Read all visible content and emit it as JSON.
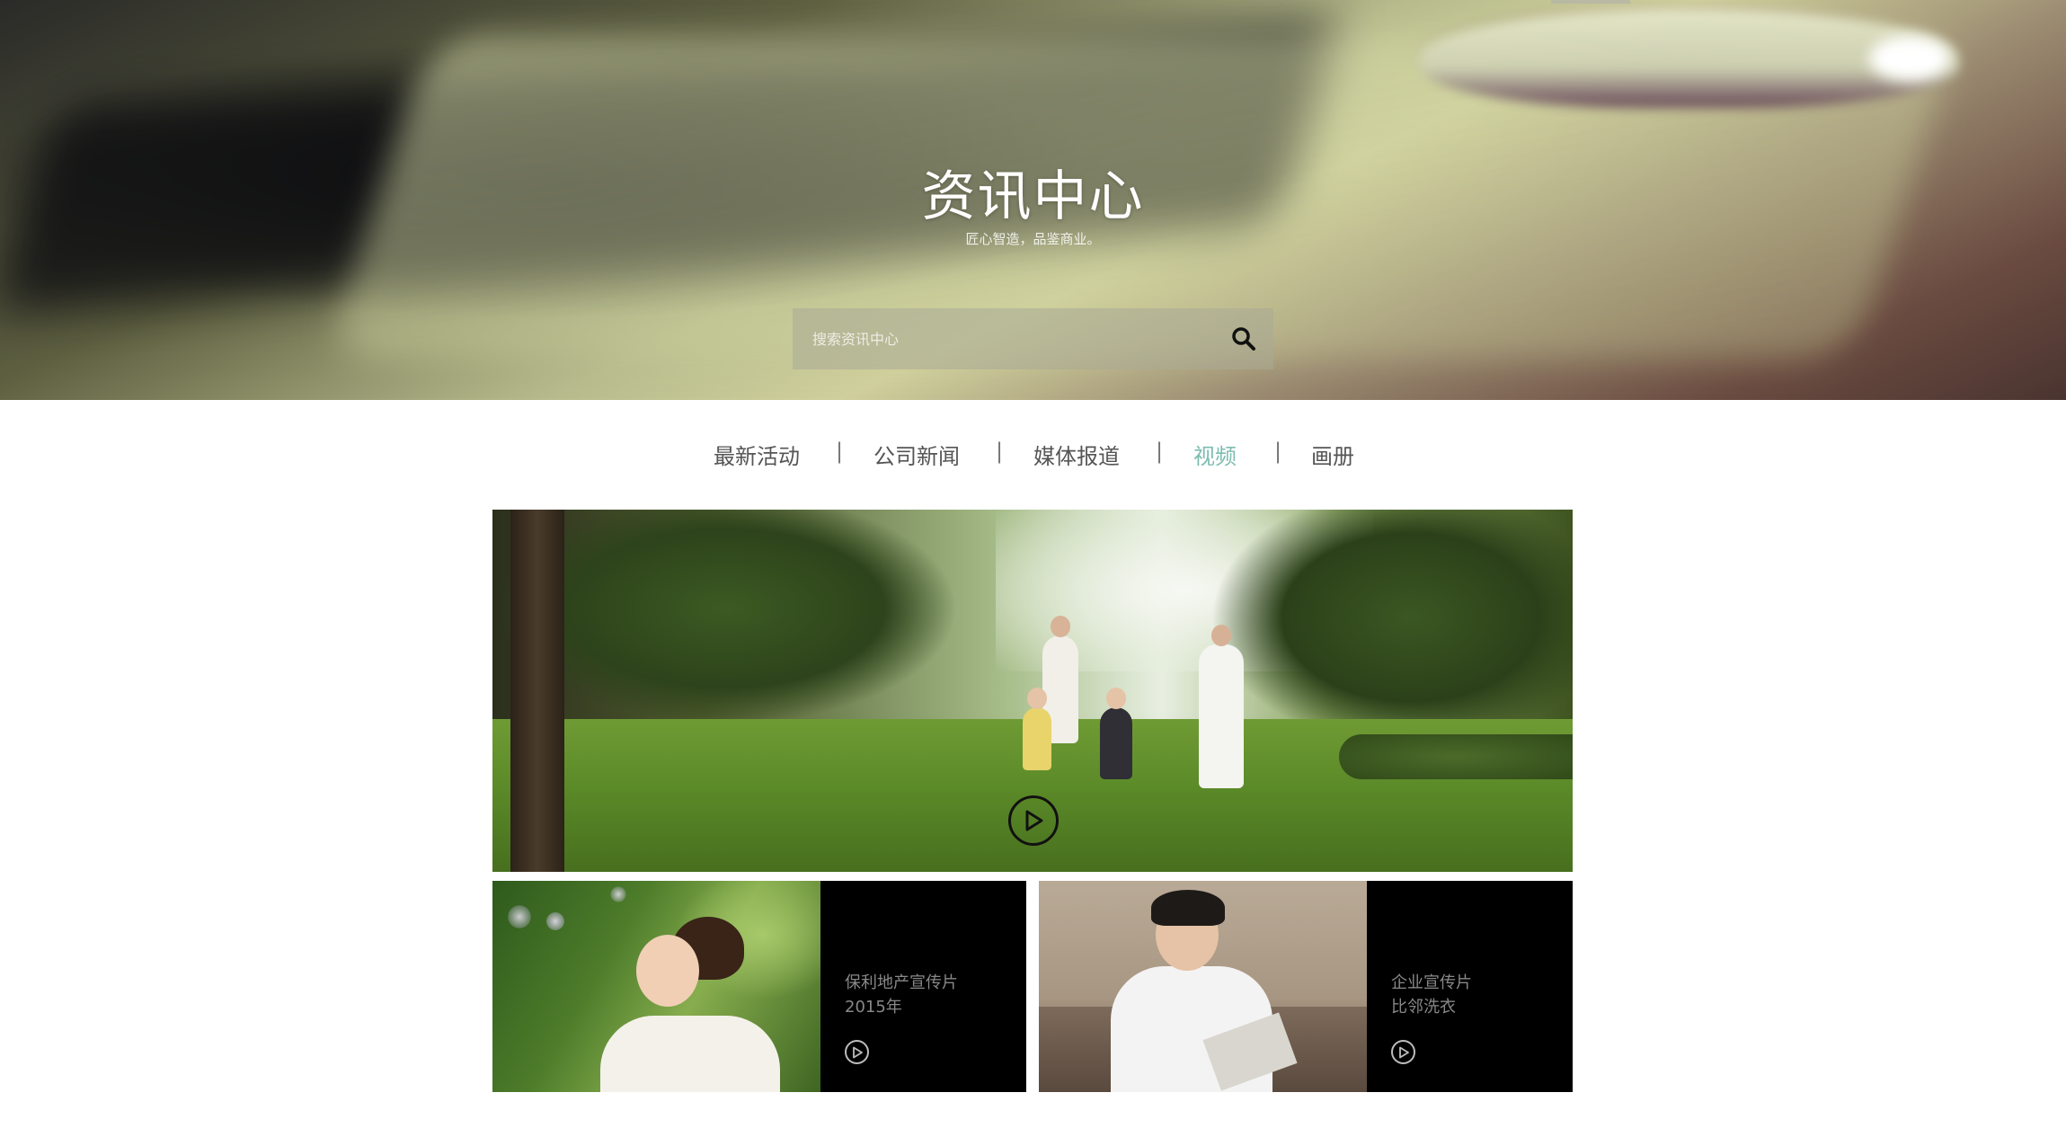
{
  "hero": {
    "title": "资讯中心",
    "subtitle": "匠心智造，品鉴商业。",
    "search": {
      "placeholder": "搜索资讯中心",
      "value": "",
      "icon": "search-icon"
    }
  },
  "nav": {
    "items": [
      {
        "label": "最新活动",
        "active": false
      },
      {
        "label": "公司新闻",
        "active": false
      },
      {
        "label": "媒体报道",
        "active": false
      },
      {
        "label": "视频",
        "active": true
      },
      {
        "label": "画册",
        "active": false
      }
    ],
    "separator": "|",
    "active_color": "#7dbdb0"
  },
  "featured_video": {
    "icon": "play-circle-icon"
  },
  "videos": [
    {
      "line1": "保利地产宣传片",
      "line2": "2015年",
      "icon": "play-circle-icon"
    },
    {
      "line1": "企业宣传片",
      "line2": "比邻洗衣",
      "icon": "play-circle-icon"
    }
  ]
}
